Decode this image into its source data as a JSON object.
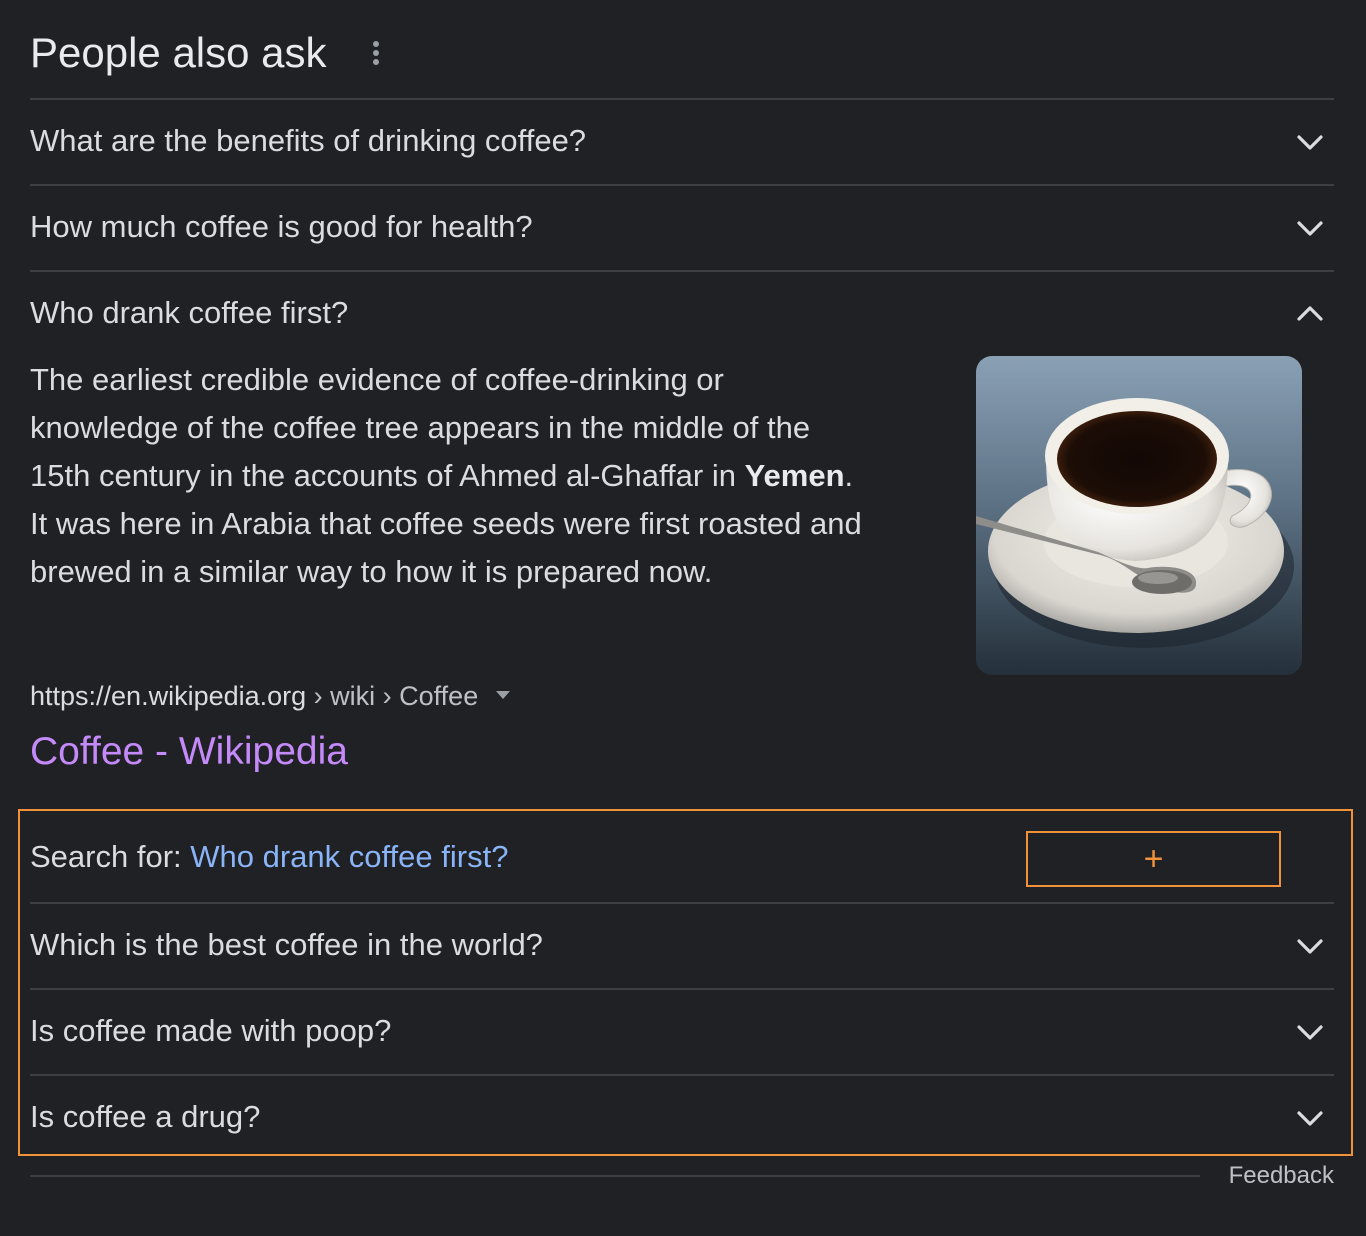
{
  "header": {
    "title": "People also ask"
  },
  "questions": [
    {
      "label": "What are the benefits of drinking coffee?"
    },
    {
      "label": "How much coffee is good for health?"
    },
    {
      "label": "Who drank coffee first?"
    }
  ],
  "expanded": {
    "answer_lines": [
      "The earliest credible evidence of coffee-drinking or",
      "knowledge of the coffee tree appears in the middle of the",
      "15th century in the accounts of Ahmed al-Ghaffar in ",
      "It was here in Arabia that coffee seeds were first roasted and",
      "brewed in a similar way to how it is prepared now."
    ],
    "answer_bold": "Yemen",
    "answer_after_bold": ".",
    "image_subject": "coffee-cup",
    "source_host": "https://en.wikipedia.org",
    "source_path": " › wiki › Coffee",
    "result_title": "Coffee - Wikipedia",
    "search_for_label": "Search for: ",
    "search_for_query": "Who drank coffee first?",
    "plus_symbol": "+"
  },
  "more_questions": [
    {
      "label": "Which is the best coffee in the world?"
    },
    {
      "label": "Is coffee made with poop?"
    },
    {
      "label": "Is coffee a drug?"
    }
  ],
  "footer": {
    "feedback": "Feedback"
  },
  "colors": {
    "background": "#202124",
    "divider": "#3c4043",
    "link_visited": "#c58af9",
    "link": "#8ab4f8",
    "highlight": "#f0923a"
  },
  "icons": {
    "more": "more-vert-icon",
    "expand": "chevron-down-icon",
    "collapse": "chevron-up-icon"
  }
}
